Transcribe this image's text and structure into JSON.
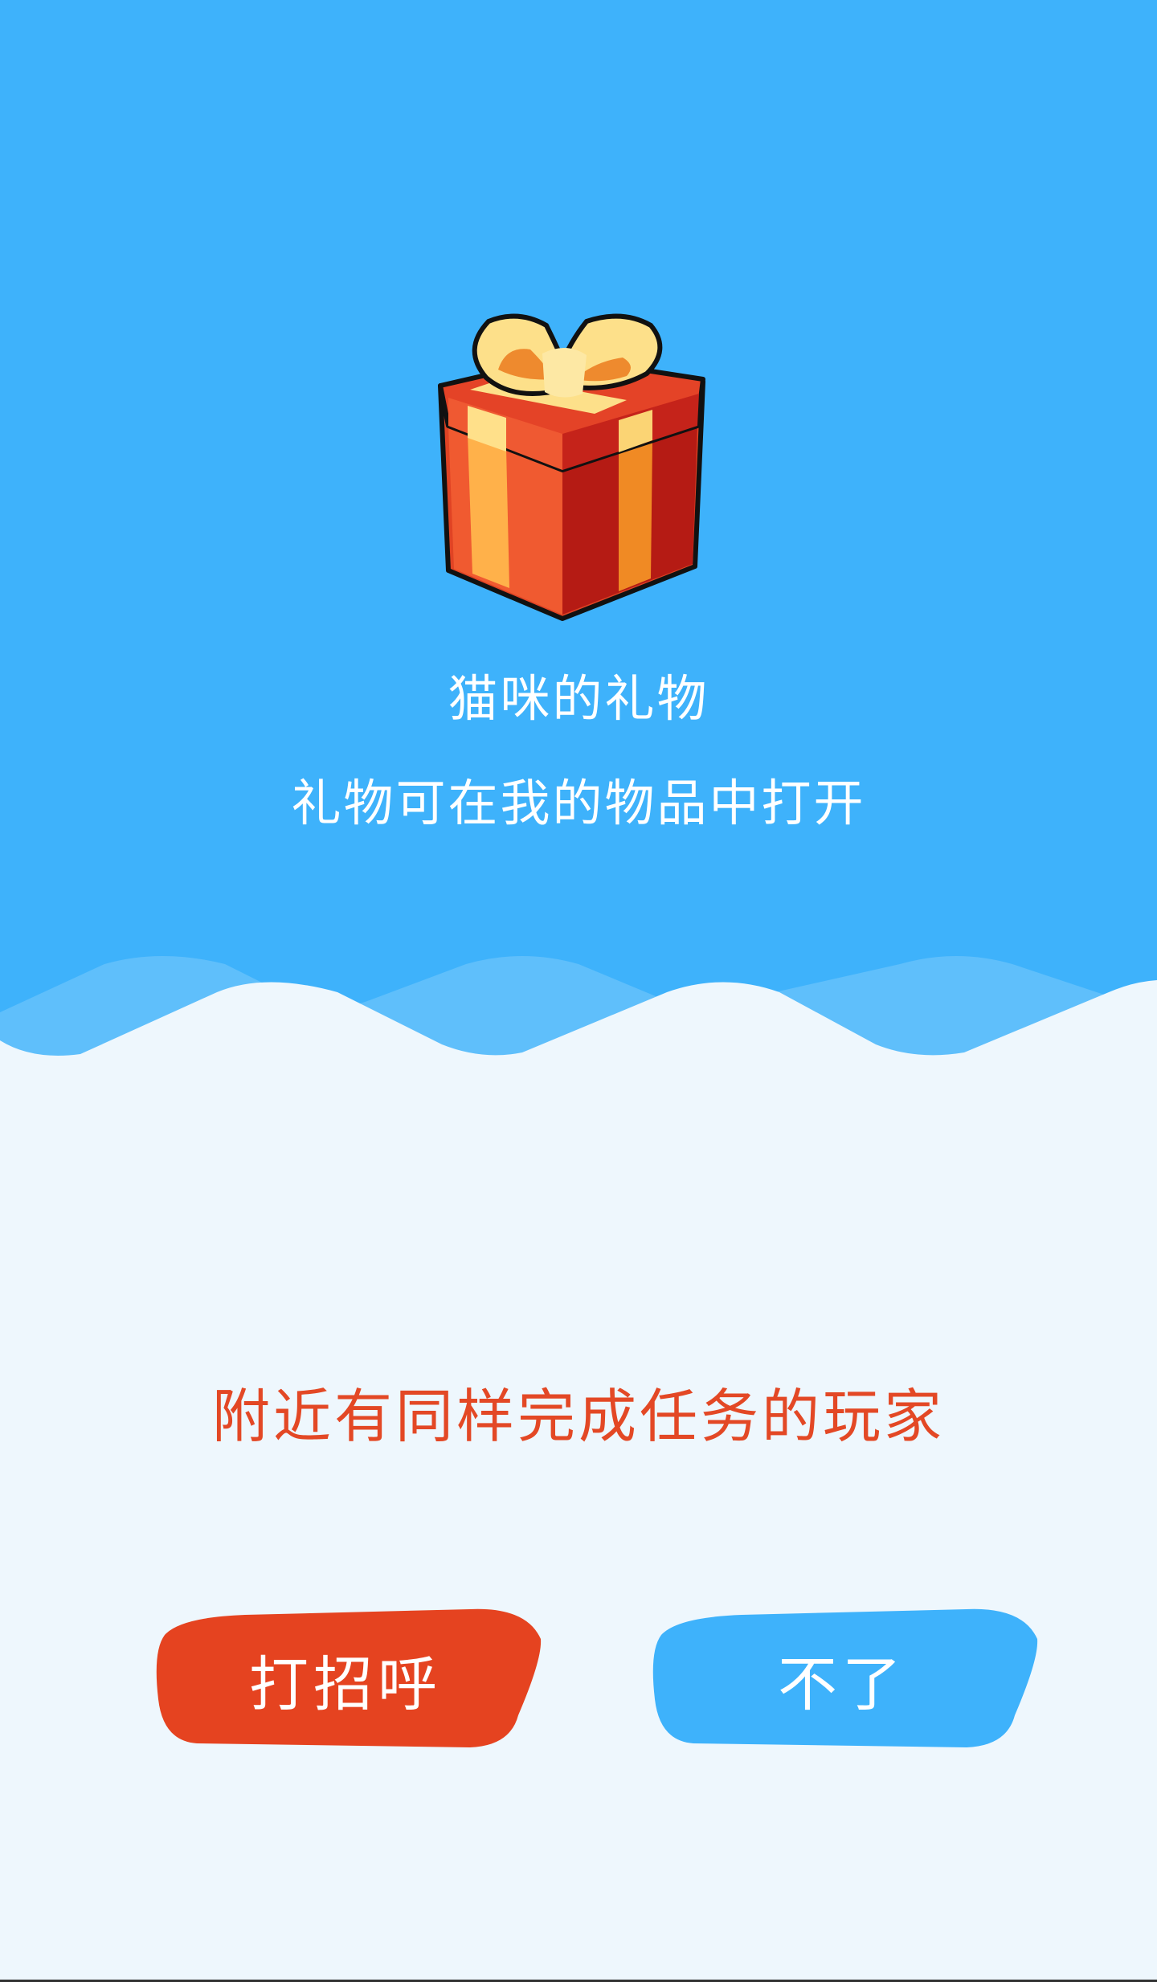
{
  "gift": {
    "icon": "gift-box-icon",
    "title": "猫咪的礼物",
    "subtitle": "礼物可在我的物品中打开"
  },
  "nearby": {
    "message": "附近有同样完成任务的玩家"
  },
  "actions": {
    "greet_label": "打招呼",
    "decline_label": "不了"
  },
  "colors": {
    "sky": "#3eb2fb",
    "snow": "#eef7fd",
    "accent_red": "#e34825",
    "accent_blue": "#3eb2fb"
  }
}
